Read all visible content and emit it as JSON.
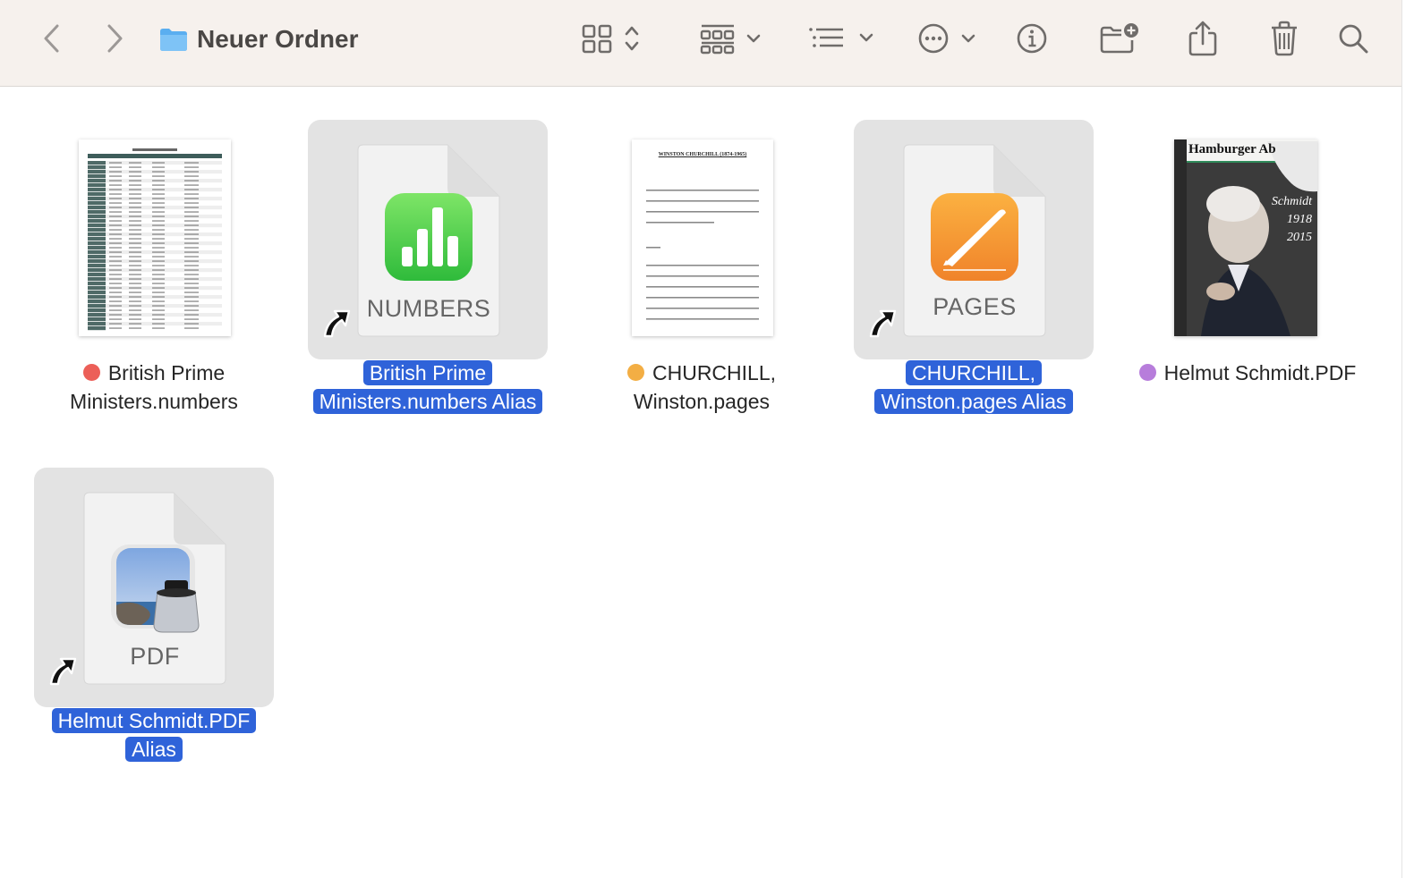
{
  "window": {
    "title": "Neuer Ordner"
  },
  "toolbar": {
    "back_icon": "chevron-left-icon",
    "forward_icon": "chevron-right-icon",
    "folder_icon": "folder-icon",
    "view_icon": "icon-grid-view-icon",
    "group_icon": "group-by-icon",
    "sort_icon": "sort-list-icon",
    "action_icon": "more-actions-icon",
    "info_icon": "info-icon",
    "new_folder_icon": "new-folder-icon",
    "share_icon": "share-icon",
    "trash_icon": "trash-icon",
    "search_icon": "search-icon"
  },
  "colors": {
    "selection": "#2f63d9",
    "tag_red": "#ec5f58",
    "tag_orange": "#f3ae44",
    "tag_purple": "#b77ddb",
    "toolbar_bg": "#f6f1ed"
  },
  "files": [
    {
      "line1": "British Prime",
      "line2": "Ministers.numbers",
      "tag": "red",
      "selected": false,
      "kind": "numbers-preview"
    },
    {
      "line1": "British Prime",
      "line2": "Ministers.numbers Alias",
      "selected": true,
      "kind": "alias",
      "doc_label": "NUMBERS"
    },
    {
      "line1": "CHURCHILL,",
      "line2": "Winston.pages",
      "tag": "orange",
      "selected": false,
      "kind": "pages-preview",
      "preview_heading": "WINSTON CHURCHILL (1874-1965)"
    },
    {
      "line1": "CHURCHILL,",
      "line2": "Winston.pages Alias",
      "selected": true,
      "kind": "alias",
      "doc_label": "PAGES"
    },
    {
      "line1": "Helmut Schmidt.PDF",
      "line2": "",
      "tag": "purple",
      "selected": false,
      "kind": "pdf-preview",
      "cover_masthead": "Hamburger Ab",
      "cover_text": "Schmidt 1918 2015"
    },
    {
      "line1": "Helmut Schmidt.PDF",
      "line2": "Alias",
      "selected": true,
      "kind": "alias",
      "doc_label": "PDF"
    }
  ]
}
